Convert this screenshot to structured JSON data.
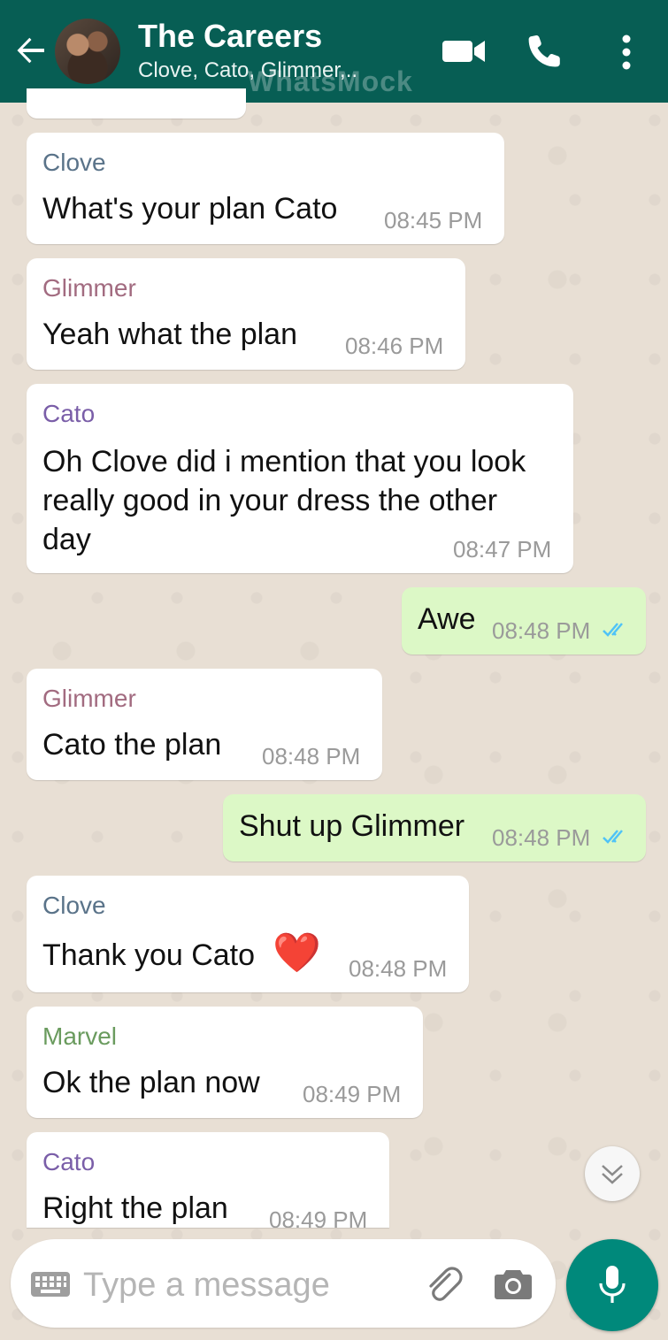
{
  "header": {
    "title": "The Careers",
    "subtitle": "Clove, Cato, Glimmer,..",
    "watermark": "WhatsMock",
    "icons": [
      "back-arrow-icon",
      "video-call-icon",
      "phone-icon",
      "more-options-icon"
    ]
  },
  "colors": {
    "header": "#075e54",
    "incoming_bubble": "#ffffff",
    "outgoing_bubble": "#dcf8c6",
    "read_ticks": "#4fc3f7",
    "mic_button": "#00897b",
    "sender_clove": "#5a7389",
    "sender_glimmer": "#a26b80",
    "sender_cato": "#7a5ea8",
    "sender_marvel": "#6a9b5e"
  },
  "messages": [
    {
      "sender": "Clove",
      "text": "What's your plan Cato",
      "time": "08:45 PM",
      "direction": "in"
    },
    {
      "sender": "Glimmer",
      "text": "Yeah what the plan",
      "time": "08:46 PM",
      "direction": "in"
    },
    {
      "sender": "Cato",
      "text_lines": [
        "Oh Clove did i mention that you look",
        "really good in your dress the other",
        "day"
      ],
      "time": "08:47 PM",
      "direction": "in"
    },
    {
      "text": "Awe",
      "time": "08:48 PM",
      "direction": "out",
      "status": "read"
    },
    {
      "sender": "Glimmer",
      "text": "Cato the plan",
      "time": "08:48 PM",
      "direction": "in"
    },
    {
      "text": "Shut up Glimmer",
      "time": "08:48 PM",
      "direction": "out",
      "status": "read"
    },
    {
      "sender": "Clove",
      "text": "Thank you Cato",
      "emoji": "❤️",
      "time": "08:48 PM",
      "direction": "in"
    },
    {
      "sender": "Marvel",
      "text": "Ok the plan now",
      "time": "08:49 PM",
      "direction": "in"
    },
    {
      "sender": "Cato",
      "text": "Right the plan",
      "time": "08:49 PM",
      "direction": "in"
    }
  ],
  "input": {
    "placeholder": "Type a message",
    "icons": [
      "keyboard-icon",
      "attach-icon",
      "camera-icon",
      "mic-icon"
    ]
  }
}
